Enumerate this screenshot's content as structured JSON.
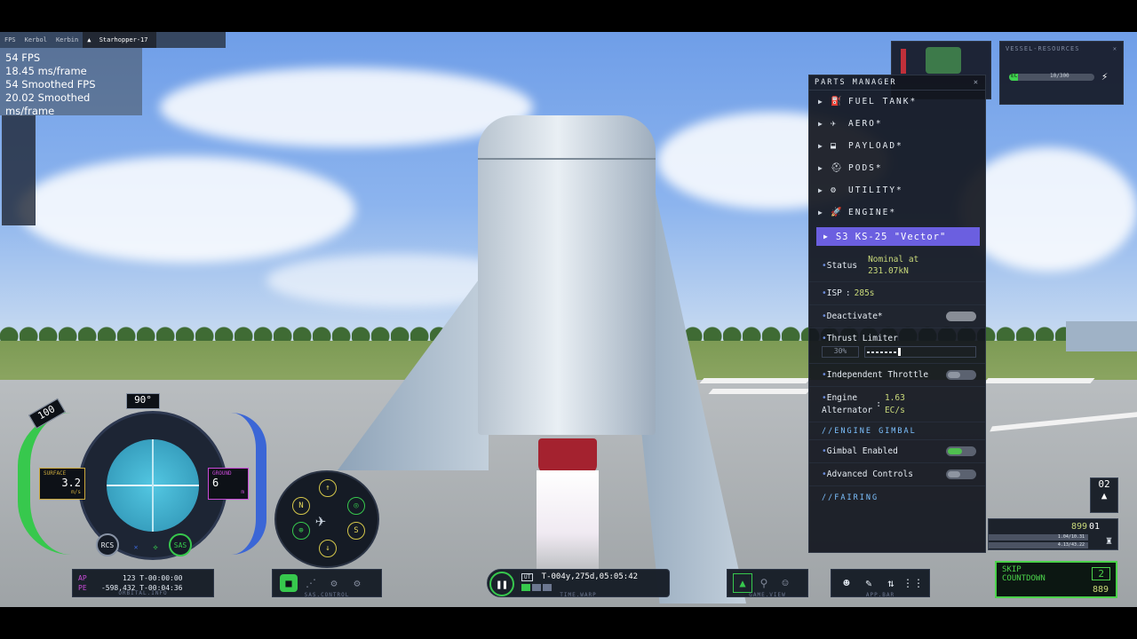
{
  "top_tabs": [
    "FPS",
    "Kerbol",
    "Kerbin",
    "Starhopper-17"
  ],
  "fps": {
    "fps": "54 FPS",
    "ms": "18.45 ms/frame",
    "smoothed_fps": "54 Smoothed FPS",
    "smoothed_ms": "20.02 Smoothed ms/frame"
  },
  "resources": {
    "title": "VESSEL-RESOURCES",
    "ec_label": "EC",
    "ec_value": "10/300",
    "ec_fraction": 0.1
  },
  "parts_manager": {
    "title": "PARTS MANAGER",
    "categories": [
      {
        "label": "FUEL TANK*",
        "icon": "fuel-tank-icon"
      },
      {
        "label": "AERO*",
        "icon": "aero-icon"
      },
      {
        "label": "PAYLOAD*",
        "icon": "payload-icon"
      },
      {
        "label": "PODS*",
        "icon": "pods-icon"
      },
      {
        "label": "UTILITY*",
        "icon": "utility-icon"
      },
      {
        "label": "ENGINE*",
        "icon": "engine-icon"
      }
    ],
    "selected_part": "S3 KS-25 \"Vector\"",
    "status_label": "Status",
    "status_value_1": "Nominal at",
    "status_value_2": "231.07kN",
    "isp_label": "ISP",
    "isp_value": "285s",
    "deactivate_label": "Deactivate*",
    "thrust_label": "Thrust Limiter",
    "thrust_value": "30%",
    "thrust_fraction": 0.3,
    "indep_throttle_label": "Independent Throttle",
    "alternator_label_1": "Engine",
    "alternator_label_2": "Alternator",
    "alternator_value_1": "1.63",
    "alternator_value_2": "EC/s",
    "gimbal_section": "ENGINE GIMBAL",
    "gimbal_enabled_label": "Gimbal Enabled",
    "advanced_controls_label": "Advanced Controls",
    "fairing_section": "FAIRING"
  },
  "navball": {
    "heading": "90°",
    "throttle": "100",
    "speed_mode": "SURFACE",
    "speed_value": "3.2",
    "speed_unit": "m/s",
    "alt_mode": "GROUND",
    "alt_value": "6",
    "alt_unit": "m",
    "rcs": "RCS",
    "sas": "SAS"
  },
  "sas_control": {
    "label": "SAS.CONTROL",
    "buttons": [
      "N",
      "S"
    ]
  },
  "orbit": {
    "label": "ORBITAL.INFO",
    "ap_label": "AP",
    "ap_value": "123",
    "pe_label": "PE",
    "pe_value": "-598,432",
    "ap_time": "T-00:00:00",
    "pe_time": "T-00:04:36"
  },
  "time": {
    "label": "TIME.WARP",
    "ut": "UT",
    "value": "T-004y,275d,05:05:42"
  },
  "game_view": {
    "label": "GAME.VIEW"
  },
  "app_bar": {
    "label": "APP.BAR"
  },
  "stage": {
    "number": "02",
    "time": "899",
    "count": "01",
    "bar1": "1.04/10.31",
    "bar2": "4.13/43.22"
  },
  "skip": {
    "line1": "SKIP",
    "line2": "COUNTDOWN",
    "count": "2",
    "value": "889"
  }
}
